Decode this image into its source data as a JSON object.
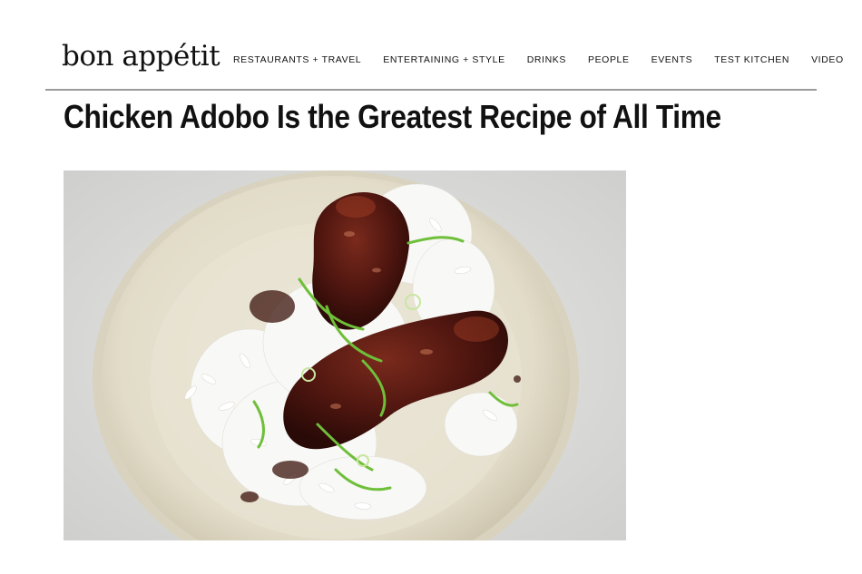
{
  "site": {
    "logo": "bon appétit"
  },
  "nav": {
    "items": [
      {
        "label": "RESTAURANTS + TRAVEL",
        "name": "nav-restaurants-travel"
      },
      {
        "label": "ENTERTAINING + STYLE",
        "name": "nav-entertaining-style"
      },
      {
        "label": "DRINKS",
        "name": "nav-drinks"
      },
      {
        "label": "PEOPLE",
        "name": "nav-people"
      },
      {
        "label": "EVENTS",
        "name": "nav-events"
      },
      {
        "label": "TEST KITCHEN",
        "name": "nav-test-kitchen"
      },
      {
        "label": "VIDEO",
        "name": "nav-video"
      }
    ]
  },
  "article": {
    "title": "Chicken Adobo Is the Greatest Recipe of All Time"
  },
  "colors": {
    "background": "#ffffff",
    "text": "#111111",
    "divider": "#9a9a9a"
  }
}
